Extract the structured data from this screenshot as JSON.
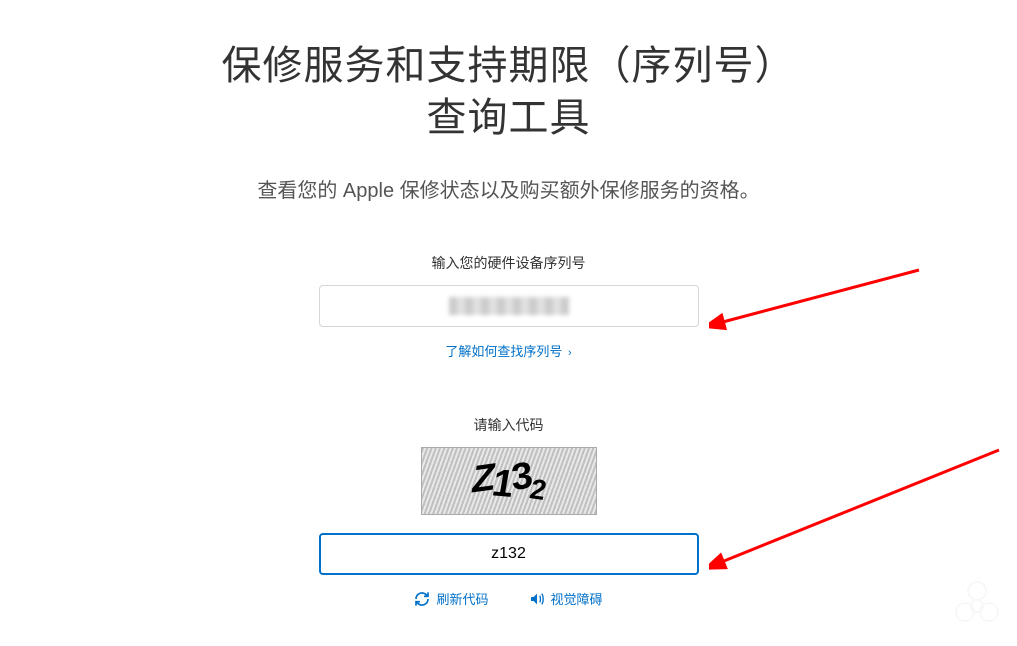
{
  "header": {
    "title_line1": "保修服务和支持期限（序列号）",
    "title_line2": "查询工具"
  },
  "subtitle": "查看您的 Apple 保修状态以及购买额外保修服务的资格。",
  "serial_section": {
    "label": "输入您的硬件设备序列号",
    "find_link": "了解如何查找序列号",
    "chevron": "›"
  },
  "captcha_section": {
    "label": "请输入代码",
    "captcha_chars": [
      "Z",
      "1",
      "3",
      "2"
    ],
    "input_value": "z132",
    "refresh_label": "刷新代码",
    "audio_label": "视觉障碍"
  }
}
